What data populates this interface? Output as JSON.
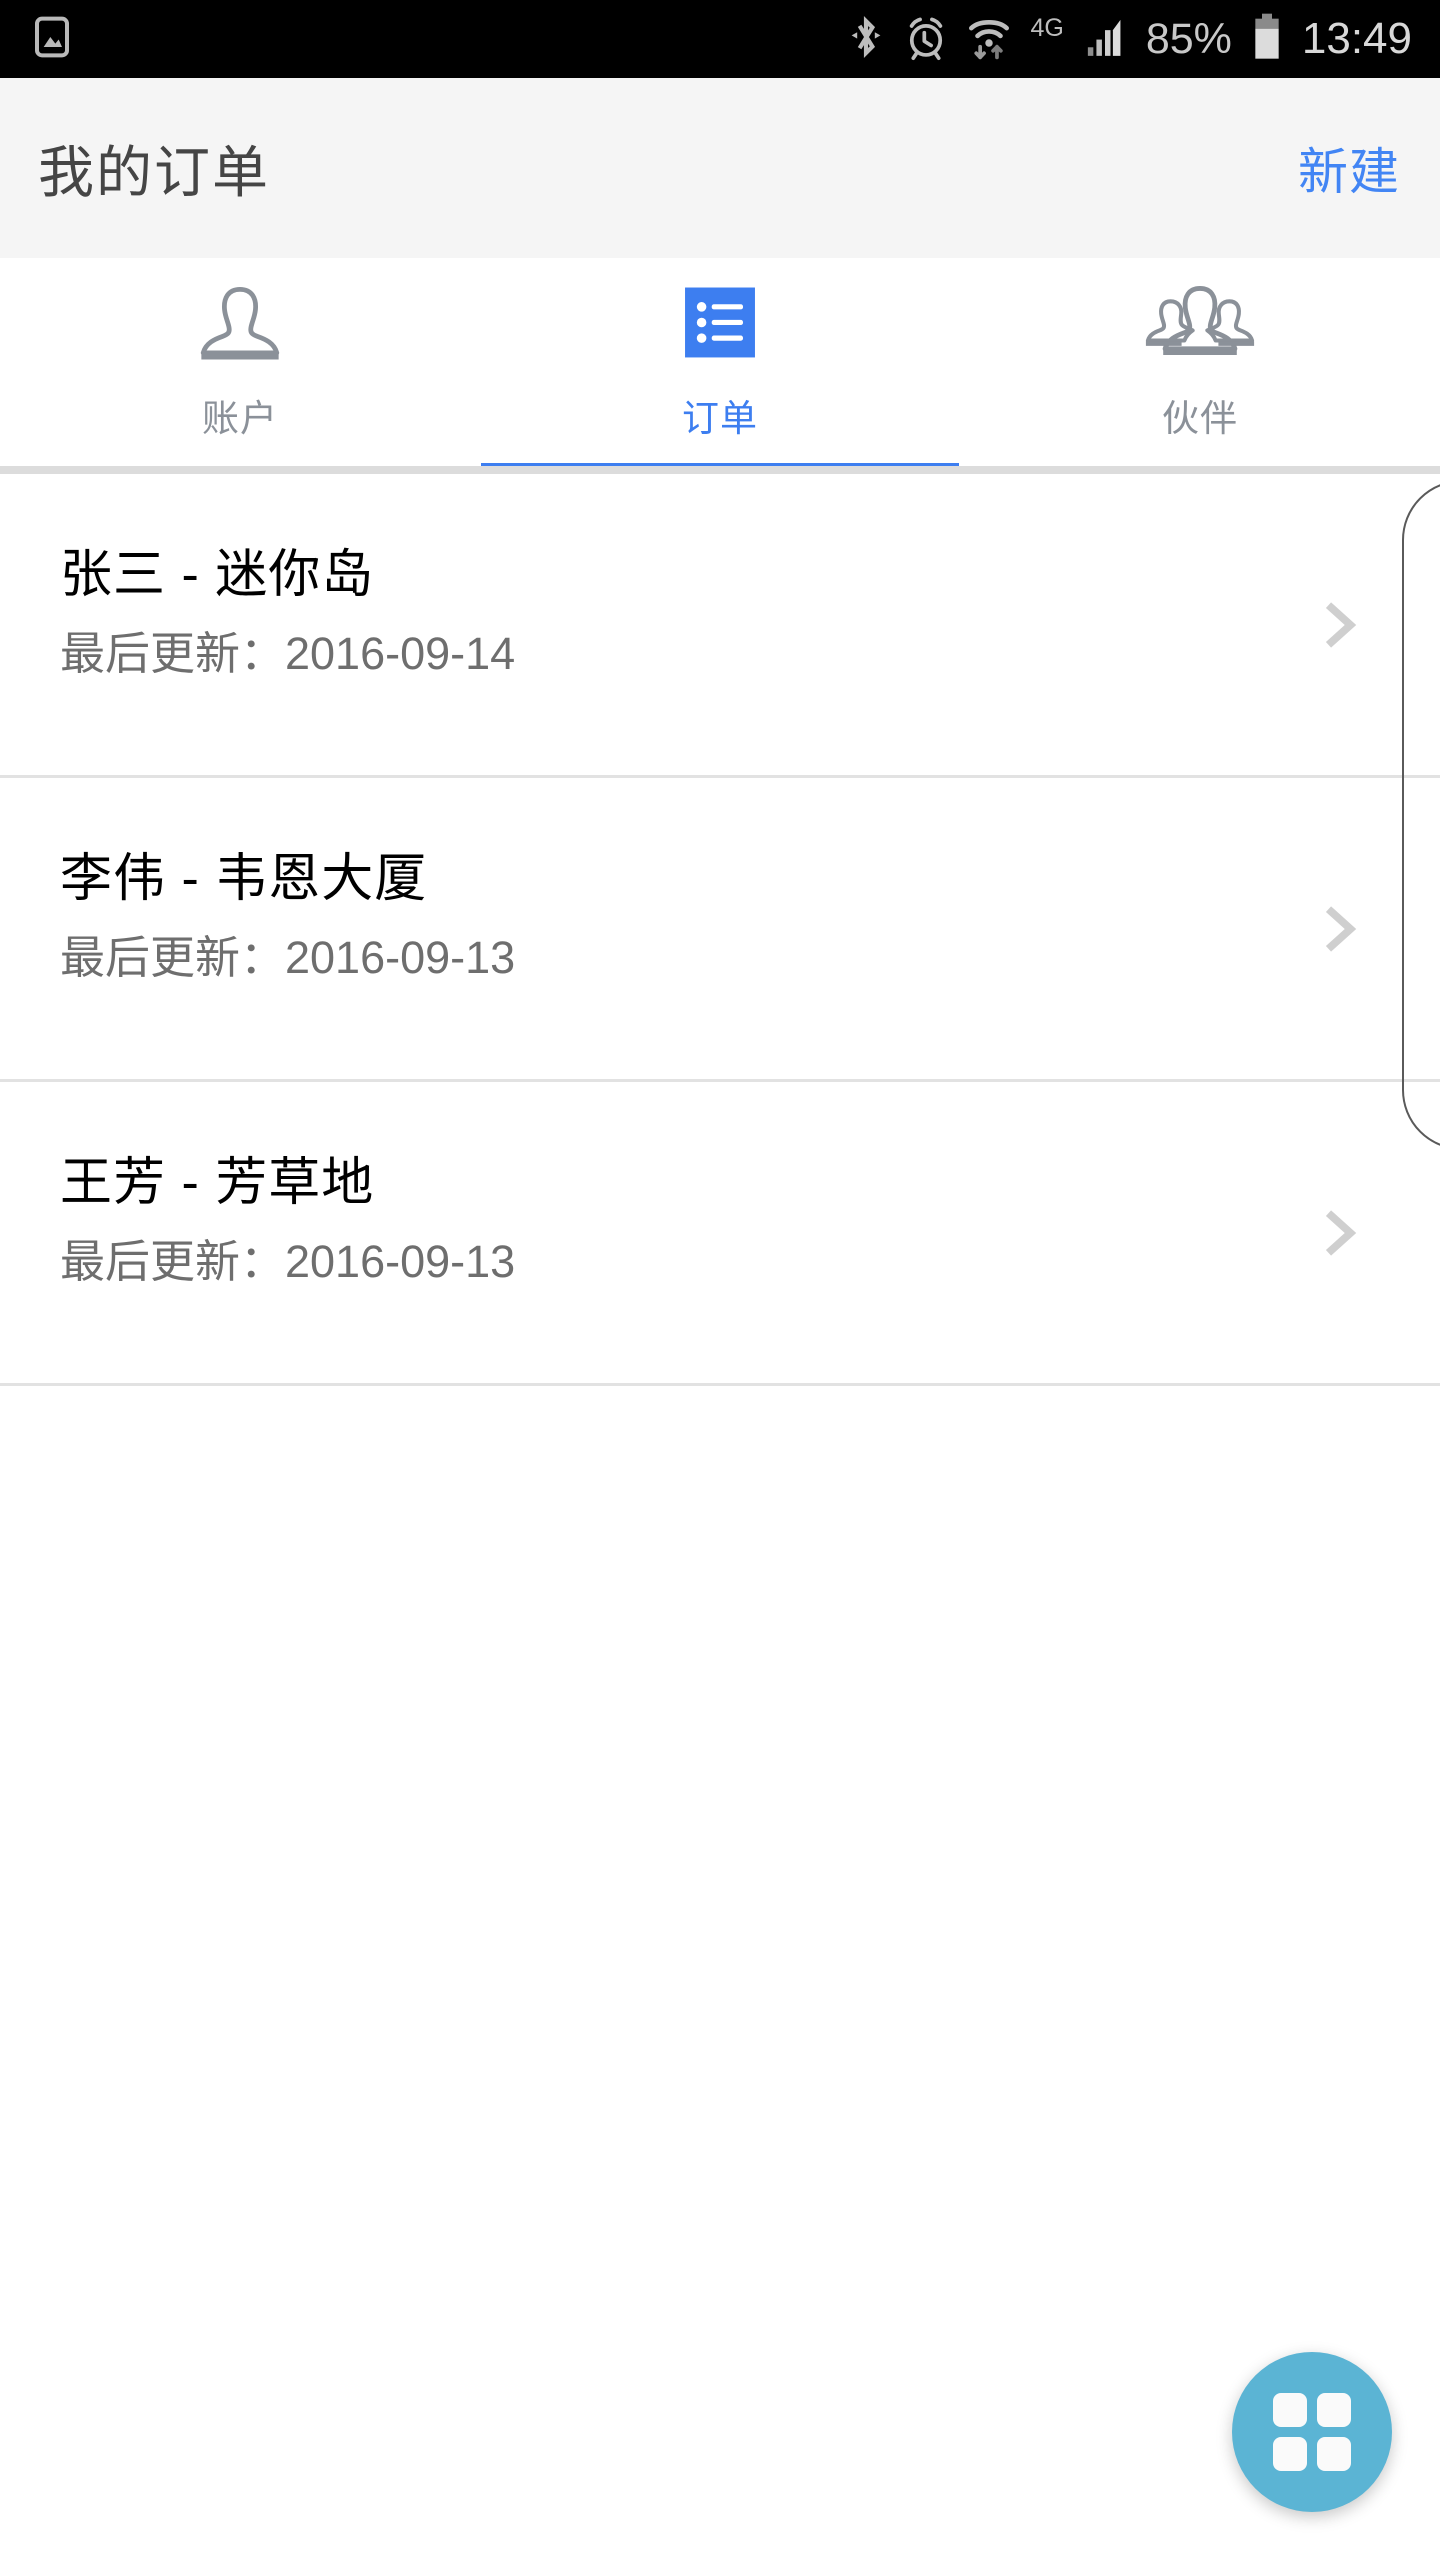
{
  "status_bar": {
    "notification_icon": "image-notification-icon",
    "icons": [
      "bluetooth-icon",
      "alarm-icon",
      "wifi-icon",
      "mobile-data-label",
      "signal-icon"
    ],
    "network_label": "4G",
    "battery_percent": "85%",
    "battery_icon": "battery-icon",
    "time": "13:49"
  },
  "header": {
    "title": "我的订单",
    "action_label": "新建"
  },
  "tabs": [
    {
      "label": "账户",
      "icon": "person-icon",
      "active": false
    },
    {
      "label": "订单",
      "icon": "list-icon",
      "active": true
    },
    {
      "label": "伙伴",
      "icon": "people-group-icon",
      "active": false
    }
  ],
  "orders": [
    {
      "title": "张三 - 迷你岛",
      "subtitle": "最后更新：2016-09-14",
      "chevron": "chevron-right-icon"
    },
    {
      "title": "李伟 - 韦恩大厦",
      "subtitle": "最后更新：2016-09-13",
      "chevron": "chevron-right-icon"
    },
    {
      "title": "王芳 - 芳草地",
      "subtitle": "最后更新：2016-09-13",
      "chevron": "chevron-right-icon"
    }
  ],
  "fab": {
    "icon": "grid-apps-icon",
    "color": "#5bb4d4"
  },
  "colors": {
    "accent_blue": "#3d7ef0",
    "action_blue": "#4285f4",
    "header_bg": "#f5f5f5",
    "tab_inactive": "#8b9199",
    "subtitle_gray": "#6e6e6e",
    "divider": "#e2e2e2",
    "fab_blue": "#5bb4d4",
    "status_bg": "#000000"
  }
}
